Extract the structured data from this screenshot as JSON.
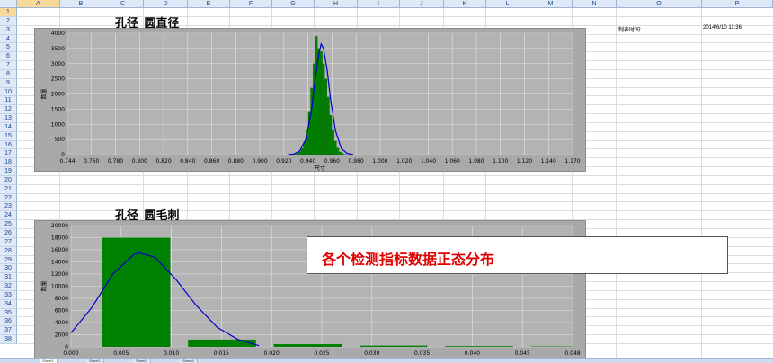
{
  "columns": [
    "A",
    "B",
    "C",
    "D",
    "E",
    "F",
    "G",
    "H",
    "I",
    "J",
    "K",
    "L",
    "M",
    "N",
    "O",
    "P"
  ],
  "selected_column": "A",
  "rows": [
    "1",
    "2",
    "3",
    "4",
    "5",
    "6",
    "7",
    "8",
    "9",
    "10",
    "11",
    "12",
    "13",
    "14",
    "15",
    "16",
    "17",
    "18",
    "19",
    "20",
    "21",
    "22",
    "23",
    "24",
    "25",
    "26",
    "27",
    "28",
    "29",
    "30",
    "31",
    "32",
    "33",
    "34",
    "35",
    "36",
    "37",
    "38"
  ],
  "selected_row": "1",
  "info": {
    "label": "制表时间:",
    "value": "2014/6/10 11:36"
  },
  "annotation": "各个检测指标数据正态分布",
  "sheet_tabs": [
    "Sheet1",
    "Sheet2",
    "Sheet3",
    "Sheet4"
  ],
  "chart_data": [
    {
      "type": "bar",
      "title": "孔径_圆直径",
      "xlabel": "尺寸",
      "ylabel": "数量",
      "xlim": [
        0.744,
        1.17
      ],
      "ylim": [
        0,
        4000
      ],
      "x_ticks": [
        "0.744",
        "0.760",
        "0.780",
        "0.800",
        "0.820",
        "0.840",
        "0.860",
        "0.880",
        "0.900",
        "0.920",
        "0.940",
        "0.960",
        "0.980",
        "1.000",
        "1.020",
        "1.040",
        "1.060",
        "1.080",
        "1.100",
        "1.120",
        "1.140",
        "1.170"
      ],
      "y_ticks": [
        "0",
        "500",
        "1000",
        "1500",
        "2000",
        "2500",
        "3000",
        "3500",
        "4000"
      ],
      "bin_width": 0.002,
      "series": [
        {
          "type": "bar",
          "color": "#008000",
          "x": [
            0.934,
            0.936,
            0.938,
            0.94,
            0.942,
            0.944,
            0.946,
            0.948,
            0.95,
            0.952,
            0.954,
            0.956,
            0.958,
            0.96,
            0.962,
            0.964,
            0.966,
            0.968,
            0.97,
            0.972,
            0.974,
            0.976,
            0.978
          ],
          "values": [
            8,
            15,
            40,
            90,
            200,
            420,
            800,
            1400,
            2200,
            3000,
            3900,
            3500,
            3400,
            3000,
            2500,
            1900,
            1300,
            800,
            450,
            220,
            90,
            40,
            10
          ]
        },
        {
          "type": "line",
          "color": "#0000cc",
          "x": [
            0.93,
            0.935,
            0.94,
            0.945,
            0.95,
            0.953,
            0.956,
            0.958,
            0.96,
            0.963,
            0.966,
            0.97,
            0.975,
            0.98,
            0.985
          ],
          "values": [
            0,
            20,
            120,
            500,
            1500,
            2500,
            3300,
            3650,
            3500,
            2800,
            1800,
            800,
            200,
            40,
            0
          ]
        }
      ]
    },
    {
      "type": "bar",
      "title": "孔径_圆毛刺",
      "xlabel": "尺寸",
      "ylabel": "数量",
      "xlim": [
        0,
        0.048
      ],
      "ylim": [
        0,
        20000
      ],
      "x_ticks": [
        "0.000",
        "0.005",
        "0.010",
        "0.015",
        "0.020",
        "0.025",
        "0.030",
        "0.035",
        "0.040",
        "0.045",
        "0.048"
      ],
      "y_ticks": [
        "0",
        "2000",
        "4000",
        "6000",
        "8000",
        "10000",
        "12000",
        "14000",
        "16000",
        "18000",
        "20000"
      ],
      "series": [
        {
          "type": "bar",
          "color": "#008000",
          "bins": [
            [
              0.003,
              0.0095
            ],
            [
              0.0112,
              0.0177
            ],
            [
              0.0194,
              0.0259
            ],
            [
              0.0276,
              0.0341
            ],
            [
              0.0358,
              0.0423
            ],
            [
              0.044,
              0.048
            ]
          ],
          "values": [
            18000,
            1200,
            450,
            200,
            120,
            60
          ]
        },
        {
          "type": "line",
          "color": "#0000cc",
          "x": [
            0.0,
            0.002,
            0.004,
            0.006,
            0.0065,
            0.008,
            0.01,
            0.012,
            0.014,
            0.016,
            0.018
          ],
          "values": [
            2300,
            6500,
            12000,
            15200,
            15500,
            14800,
            11200,
            6800,
            3200,
            1200,
            200
          ]
        }
      ]
    }
  ]
}
